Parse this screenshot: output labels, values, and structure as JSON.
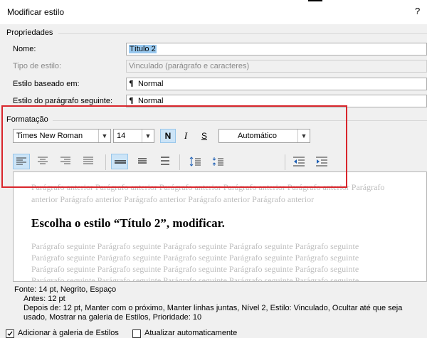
{
  "dialog": {
    "title": "Modificar estilo",
    "help": "?"
  },
  "properties": {
    "group_label": "Propriedades",
    "name_label": "Nome:",
    "name_value": "Título 2",
    "type_label": "Tipo de estilo:",
    "type_value": "Vinculado (parágrafo e caracteres)",
    "based_label": "Estilo baseado em:",
    "based_value": "Normal",
    "next_label": "Estilo do parágrafo seguinte:",
    "next_value": "Normal",
    "paragraph_glyph": "¶"
  },
  "formatting": {
    "group_label": "Formatação",
    "font": "Times New Roman",
    "size": "14",
    "bold": "N",
    "italic": "I",
    "underline": "S",
    "color": "Automático",
    "highlight_color": "#d9262c"
  },
  "preview": {
    "prev_line1": "Parágrafo anterior Parágrafo anterior Parágrafo anterior Parágrafo anterior Parágrafo anterior Parágrafo",
    "prev_line2": "anterior Parágrafo anterior Parágrafo anterior Parágrafo anterior Parágrafo anterior",
    "sample": "Escolha o estilo “Título 2”, modificar.",
    "next_lines": [
      "Parágrafo seguinte Parágrafo seguinte Parágrafo seguinte Parágrafo seguinte Parágrafo seguinte",
      "Parágrafo seguinte Parágrafo seguinte Parágrafo seguinte Parágrafo seguinte Parágrafo seguinte",
      "Parágrafo seguinte Parágrafo seguinte Parágrafo seguinte Parágrafo seguinte Parágrafo seguinte",
      "Parágrafo seguinte Parágrafo seguinte Parágrafo seguinte Parágrafo seguinte Parágrafo seguinte"
    ]
  },
  "description": {
    "line1": "Fonte: 14 pt, Negrito, Espaço",
    "line2": "Antes:  12 pt",
    "line3": "Depois de:  12 pt, Manter com o próximo, Manter linhas juntas, Nível 2, Estilo: Vinculado, Ocultar até que seja",
    "line4": "usado, Mostrar na galeria de Estilos, Prioridade: 10"
  },
  "options": {
    "add_gallery": "Adicionar à galeria de Estilos",
    "auto_update": "Atualizar automaticamente"
  }
}
